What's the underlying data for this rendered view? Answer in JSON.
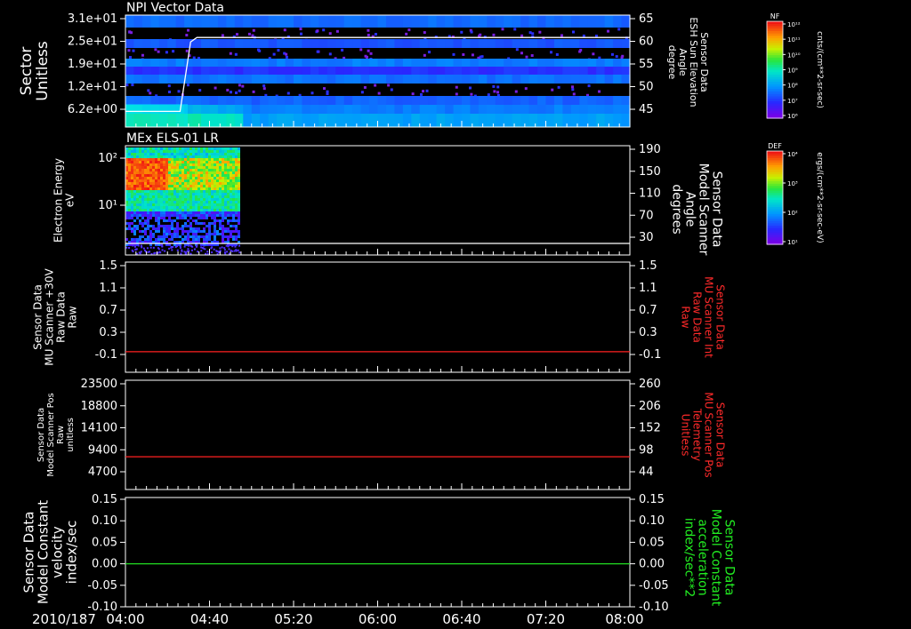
{
  "date_label": "2010/187",
  "time_ticks": [
    "04:00",
    "04:40",
    "05:20",
    "06:00",
    "06:40",
    "07:20",
    "08:00"
  ],
  "chart_data": [
    {
      "type": "heatmap",
      "title": "NPI Vector Data",
      "ylabel": [
        "Sector",
        "Unitless"
      ],
      "ytick_labels": [
        "3.1e+01",
        "2.5e+01",
        "1.9e+01",
        "1.2e+01",
        "6.2e+00"
      ],
      "right_ylabel": [
        "Sensor Data",
        "ESH Sun Elevation",
        "Angle",
        "degree"
      ],
      "right_ytick_labels": [
        "65",
        "60",
        "55",
        "50",
        "45"
      ],
      "right_ylim": [
        40,
        65
      ],
      "overlay_line": {
        "color": "#ffffff",
        "points": [
          [
            "04:00",
            43.5
          ],
          [
            "04:26",
            43.5
          ],
          [
            "04:31",
            59.0
          ],
          [
            "04:34",
            60.0
          ],
          [
            "08:00",
            60.0
          ]
        ]
      },
      "colorbar": {
        "label": "NF",
        "unit": "cnts/(cm**2-sr-sec)",
        "tick_labels": [
          "10¹²",
          "10¹¹",
          "10¹⁰",
          "10⁹",
          "10⁸",
          "10⁷",
          "10⁶"
        ]
      }
    },
    {
      "type": "heatmap",
      "title": "MEx ELS-01 LR",
      "ylabel": [
        "Electron Energy",
        "eV"
      ],
      "ytick_labels": [
        "10²",
        "10¹"
      ],
      "right_ylabel": [
        "Sensor Data",
        "Model Scanner",
        "Angle",
        "degrees"
      ],
      "right_ytick_labels": [
        "190",
        "150",
        "110",
        "70",
        "30"
      ],
      "data_end": "04:54",
      "overlay_line": {
        "color": "#ffffff",
        "points": [
          [
            "04:00",
            10
          ],
          [
            "08:00",
            10
          ]
        ]
      },
      "colorbar": {
        "label": "DEF",
        "unit": "ergs/(cm**2-sr-sec-eV)",
        "tick_labels": [
          "10⁴",
          "10³",
          "10²",
          "10¹"
        ]
      }
    },
    {
      "type": "line",
      "ylabel": [
        "Sensor Data",
        "MU Scanner +30V",
        "Raw Data",
        "Raw"
      ],
      "ytick_labels": [
        "1.5",
        "1.1",
        "0.7",
        "0.3",
        "-0.1"
      ],
      "right_ylabel": [
        "Sensor Data",
        "MU Scanner Int",
        "Raw Data",
        "Raw"
      ],
      "right_ylabel_color": "#ff2a2a",
      "right_ytick_labels": [
        "1.5",
        "1.1",
        "0.7",
        "0.3",
        "-0.1"
      ],
      "series": [
        {
          "color": "#ff2020",
          "x": [
            "04:00",
            "08:00"
          ],
          "y": [
            -0.05,
            -0.05
          ]
        }
      ]
    },
    {
      "type": "line",
      "ylabel": [
        "Sensor Data",
        "Model Scanner Pos",
        "Raw",
        "unitless"
      ],
      "ytick_labels": [
        "23500",
        "18800",
        "14100",
        "9400",
        "4700"
      ],
      "right_ylabel": [
        "Sensor Data",
        "MU Scanner Pos",
        "Telemetry",
        "Unitless"
      ],
      "right_ylabel_color": "#ff2a2a",
      "right_ytick_labels": [
        "260",
        "206",
        "152",
        "98",
        "44"
      ],
      "series": [
        {
          "color": "#ff2020",
          "x": [
            "04:00",
            "08:00"
          ],
          "y": [
            7900,
            7900
          ]
        }
      ]
    },
    {
      "type": "line",
      "ylabel": [
        "Sensor Data",
        "Model Constant",
        "velocity",
        "index/sec"
      ],
      "ytick_labels": [
        "0.15",
        "0.10",
        "0.05",
        "0.00",
        "-0.05",
        "-0.10"
      ],
      "right_ylabel": [
        "Sensor Data",
        "Model Constant",
        "acceleration",
        "index/sec**2"
      ],
      "right_ylabel_color": "#22ee22",
      "right_ytick_labels": [
        "0.15",
        "0.10",
        "0.05",
        "0.00",
        "-0.05",
        "-0.10"
      ],
      "series": [
        {
          "color": "#22dd22",
          "x": [
            "04:00",
            "08:00"
          ],
          "y": [
            0.0,
            0.0
          ]
        }
      ]
    }
  ]
}
